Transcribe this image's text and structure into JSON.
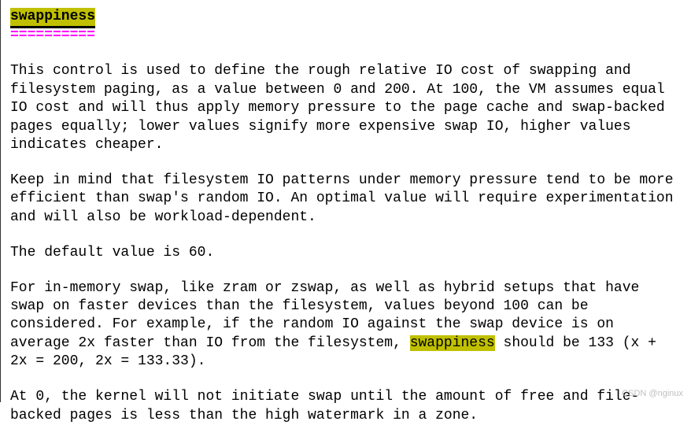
{
  "title": "swappiness",
  "underline": "==========",
  "para1": "This control is used to define the rough relative IO cost of swapping and filesystem paging, as a value between 0 and 200. At 100, the VM assumes equal IO cost and will thus apply memory pressure to the page cache and swap-backed pages equally; lower values signify more expensive swap IO, higher values indicates cheaper.",
  "para2": "Keep in mind that filesystem IO patterns under memory pressure tend to be more efficient than swap's random IO. An optimal value will require experimentation and will also be workload-dependent.",
  "para3": "The default value is 60.",
  "para4_pre": "For in-memory swap, like zram or zswap, as well as hybrid setups that have swap on faster devices than the filesystem, values beyond 100 can be considered. For example, if the random IO against the swap device is on average 2x faster than IO from the filesystem, ",
  "para4_hl": "swappiness",
  "para4_post": " should be 133 (x + 2x = 200, 2x = 133.33).",
  "para5": "At 0, the kernel will not initiate swap until the amount of free and file-backed pages is less than the high watermark in a zone.",
  "watermark": "CSDN @nginux"
}
